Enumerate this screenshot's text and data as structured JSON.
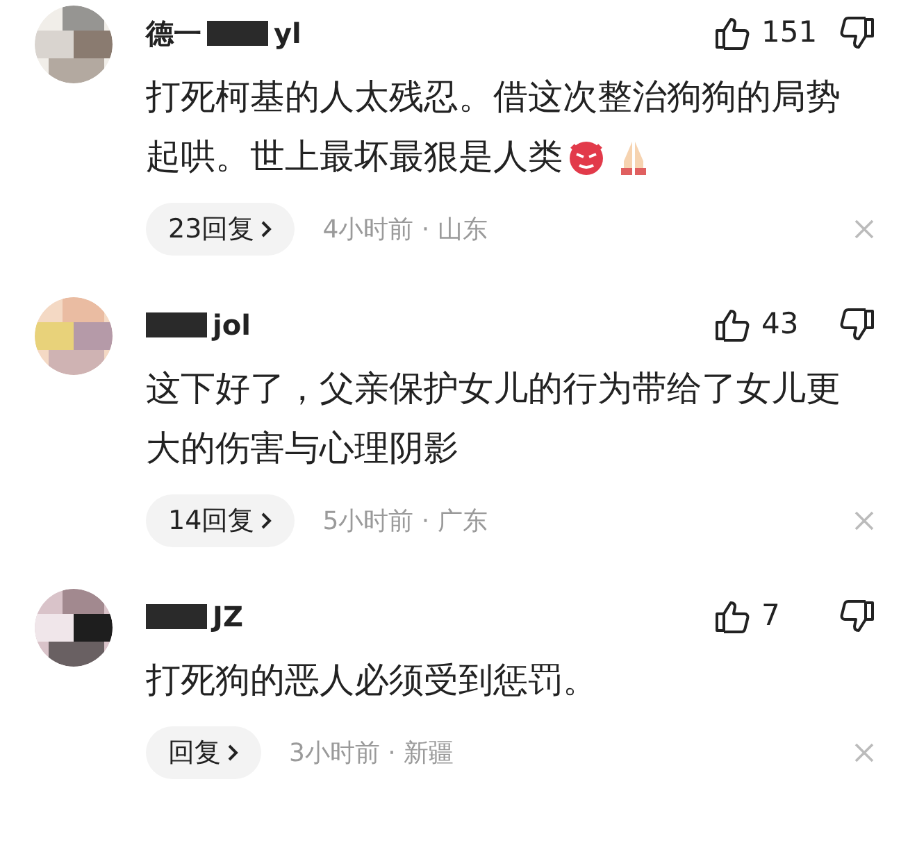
{
  "comments": [
    {
      "avatar": {
        "kind": "picture"
      },
      "name_parts": [
        {
          "kind": "text",
          "text": "德一"
        },
        {
          "kind": "redacted"
        },
        {
          "kind": "text",
          "text": "yl"
        }
      ],
      "likes": "151",
      "lines": [
        "打死柯基的人太残忍。借这次整治狗狗的局势",
        "起哄。世上最坏最狠是人类"
      ],
      "emojis": [
        {
          "kind": "devil"
        },
        {
          "kind": "pray"
        }
      ],
      "reply_label": "23回复",
      "meta": "4小时前 · 山东"
    },
    {
      "avatar": {
        "kind": "picture"
      },
      "name_parts": [
        {
          "kind": "redacted"
        },
        {
          "kind": "text",
          "text": "jol"
        }
      ],
      "likes": "43",
      "lines": [
        "这下好了，父亲保护女儿的行为带给了女儿更",
        "大的伤害与心理阴影"
      ],
      "reply_label": "14回复",
      "meta": "5小时前 · 广东"
    },
    {
      "avatar": {
        "kind": "picture"
      },
      "name_parts": [
        {
          "kind": "redacted"
        },
        {
          "kind": "text",
          "text": "JZ"
        }
      ],
      "likes": "7",
      "lines": [
        "打死狗的恶人必须受到惩罚。"
      ],
      "reply_label": "回复",
      "meta": "3小时前 · 新疆"
    }
  ]
}
